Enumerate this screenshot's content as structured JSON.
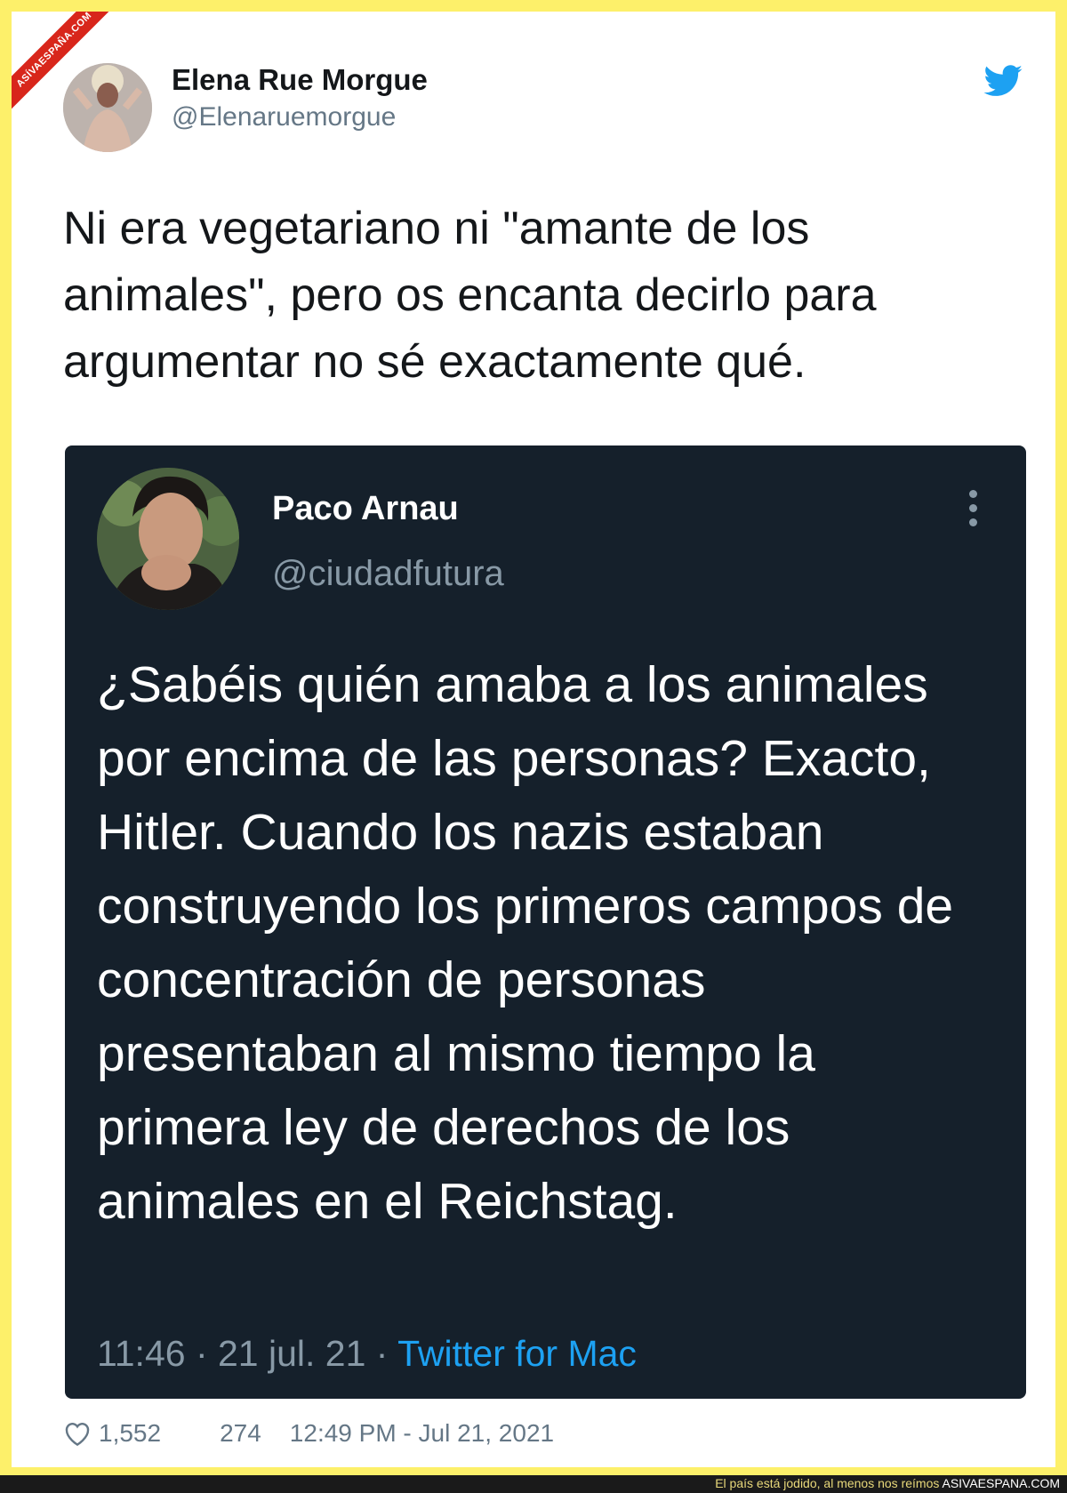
{
  "watermark": {
    "ribbon_text": "ASÍVAESPAÑA.COM"
  },
  "tweet": {
    "author_name": "Elena Rue Morgue",
    "author_handle": "@Elenaruemorgue",
    "text": "Ni era vegetariano ni \"amante de los animales\", pero os encanta decirlo para argumentar no sé exactamente qué.",
    "likes": "1,552",
    "replies": "274",
    "timestamp": "12:49 PM - Jul 21, 2021",
    "brand_icon": "twitter-bird-icon",
    "brand_color": "#1da1f2"
  },
  "quoted_tweet": {
    "author_name": "Paco Arnau",
    "author_handle": "@ciudadfutura",
    "text": "¿Sabéis quién amaba a los animales por encima de las personas? Exacto, Hitler. Cuando los nazis estaban construyendo los primeros campos de concentración de personas presentaban al mismo tiempo la primera ley de derechos de los animales en el Reichstag.",
    "time": "11:46",
    "date": "21 jul. 21",
    "source": "Twitter for Mac",
    "separator": " · ",
    "background": "#15202b"
  },
  "bottom_bar": {
    "slogan": "El país está jodido, al menos nos reímos",
    "site": "ASIVAESPANA.COM"
  },
  "colors": {
    "frame": "#fdf06a",
    "ribbon": "#d8261b"
  }
}
